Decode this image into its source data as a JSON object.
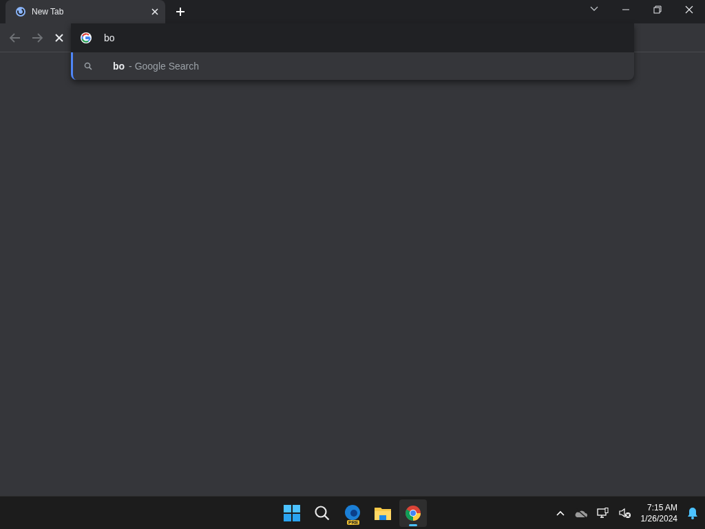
{
  "tabs": [
    {
      "title": "New Tab",
      "selected": true
    }
  ],
  "omnibox": {
    "value": "bo"
  },
  "suggestions": [
    {
      "match": "bo",
      "description": "- Google Search",
      "selected": true
    }
  ],
  "taskbar": {
    "apps": [
      {
        "kind": "start",
        "active": false
      },
      {
        "kind": "search",
        "active": false
      },
      {
        "kind": "edge",
        "badge": "PRE",
        "active": false
      },
      {
        "kind": "files",
        "active": false
      },
      {
        "kind": "chrome",
        "active": true
      }
    ],
    "clock": {
      "time": "7:15 AM",
      "date": "1/26/2024"
    }
  }
}
